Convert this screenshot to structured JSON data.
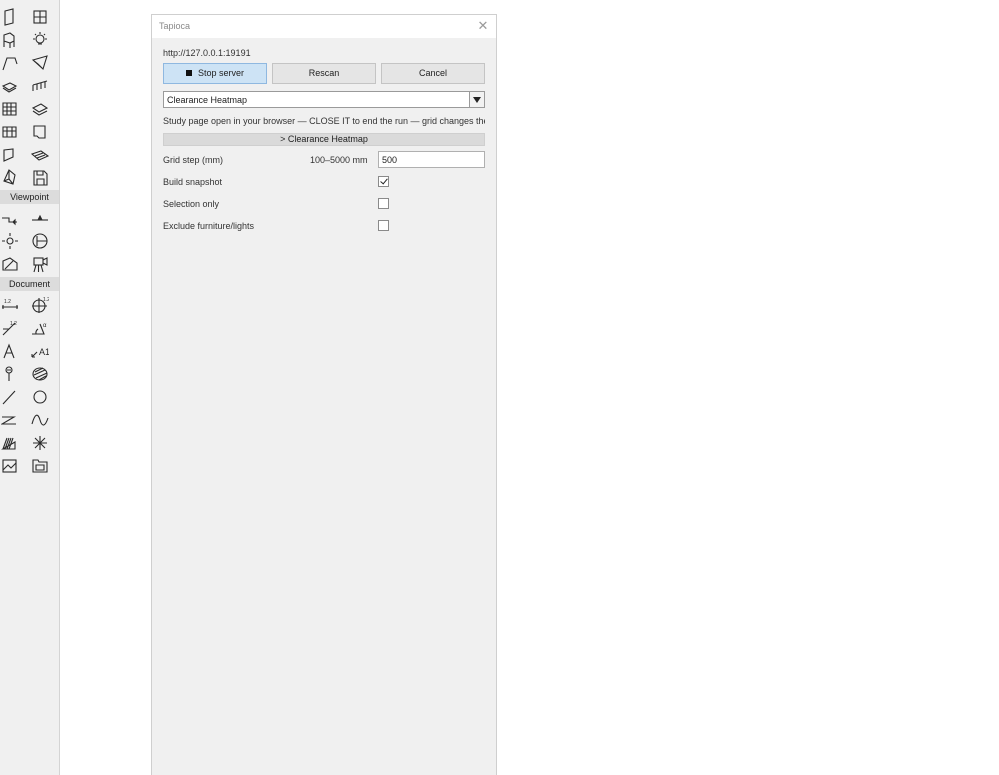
{
  "toolbox": {
    "sections": [
      {
        "label": "Viewpoint"
      },
      {
        "label": "Document"
      }
    ]
  },
  "dialog": {
    "title": "Tapioca",
    "url": "http://127.0.0.1:19191",
    "buttons": {
      "stop": "Stop server",
      "rescan": "Rescan",
      "cancel": "Cancel"
    },
    "study_select": {
      "value": "Clearance Heatmap"
    },
    "info_text": "Study page open in your browser — CLOSE IT to end the run — grid changes ther",
    "section_header": "> Clearance Heatmap",
    "fields": {
      "grid_step": {
        "label": "Grid step (mm)",
        "range": "100–5000 mm",
        "value": "500"
      },
      "build_snapshot": {
        "label": "Build snapshot",
        "checked": true
      },
      "selection_only": {
        "label": "Selection only",
        "checked": false
      },
      "exclude_furniture": {
        "label": "Exclude furniture/lights",
        "checked": false
      }
    }
  }
}
